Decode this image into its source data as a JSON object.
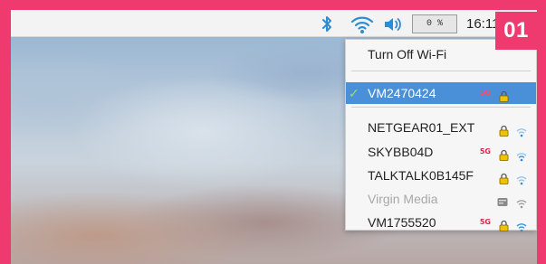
{
  "badge": {
    "label": "01"
  },
  "taskbar": {
    "cpu_label": "0 %",
    "clock": "16:11",
    "icons": [
      "bluetooth-icon",
      "wifi-icon",
      "volume-icon"
    ]
  },
  "wifi_menu": {
    "turn_off_label": "Turn Off Wi-Fi",
    "connected": {
      "name": "VM2470424",
      "tag": "5G",
      "secured": true
    },
    "networks": [
      {
        "name": "NETGEAR01_EXT",
        "tag": "",
        "secured": true,
        "disabled": false
      },
      {
        "name": "SKYBB04D",
        "tag": "5G",
        "secured": true,
        "disabled": false
      },
      {
        "name": "TALKTALK0B145F",
        "tag": "",
        "secured": true,
        "disabled": false
      },
      {
        "name": "Virgin Media",
        "tag": "",
        "secured": false,
        "disabled": true
      },
      {
        "name": "VM1755520",
        "tag": "5G",
        "secured": true,
        "disabled": false
      }
    ]
  },
  "colors": {
    "accent": "#ee3a6e",
    "selection": "#4a90d9",
    "tag_5g": "#e2264a",
    "wifi_blue": "#2a8dd6"
  }
}
